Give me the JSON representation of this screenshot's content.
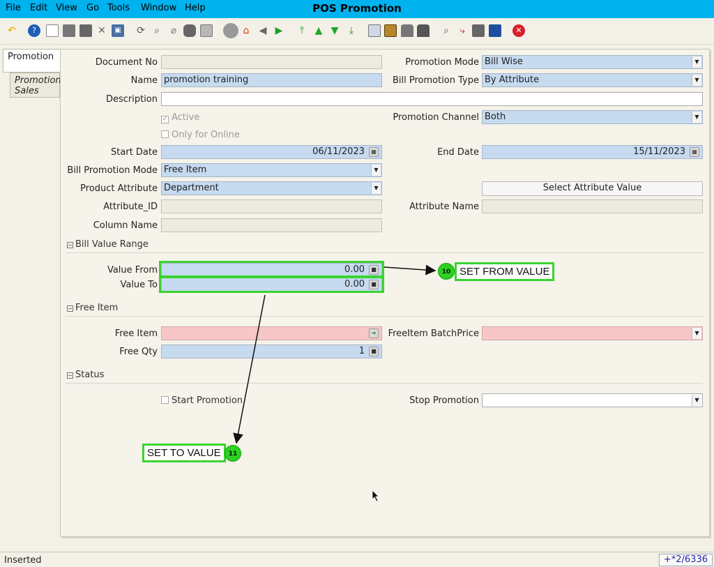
{
  "window": {
    "title": "POS Promotion"
  },
  "menu": [
    "File",
    "Edit",
    "View",
    "Go",
    "Tools",
    "Window",
    "Help"
  ],
  "toolbar_icons": [
    "undo-icon",
    "help-icon",
    "new-icon",
    "copy-icon",
    "delete-icon",
    "delete-selection-icon",
    "save-icon",
    "refresh-icon",
    "find-icon",
    "attachment-icon",
    "chat-icon",
    "history-icon",
    "detail-toggle-icon",
    "home-icon",
    "back-icon",
    "forward-icon",
    "first-record-icon",
    "previous-record-icon",
    "next-record-icon",
    "last-record-icon",
    "report-icon",
    "archive-icon",
    "print-preview-icon",
    "print-icon",
    "zoom-across-icon",
    "workflow-icon",
    "product-info-icon",
    "exit-icon",
    "close-icon"
  ],
  "tabs": [
    "Promotion",
    "Promotion Sales"
  ],
  "form": {
    "document_no": {
      "label": "Document No",
      "value": ""
    },
    "name": {
      "label": "Name",
      "value": "promotion training"
    },
    "description": {
      "label": "Description",
      "value": ""
    },
    "active": {
      "label": "Active",
      "checked": true
    },
    "only_online": {
      "label": "Only for Online",
      "checked": false
    },
    "start_date": {
      "label": "Start Date",
      "value": "06/11/2023"
    },
    "bill_promotion_mode": {
      "label": "Bill Promotion Mode",
      "value": "Free Item"
    },
    "product_attribute": {
      "label": "Product Attribute",
      "value": "Department"
    },
    "attribute_id": {
      "label": "Attribute_ID",
      "value": ""
    },
    "column_name": {
      "label": "Column Name",
      "value": ""
    },
    "promotion_mode": {
      "label": "Promotion Mode",
      "value": "Bill Wise"
    },
    "bill_promotion_type": {
      "label": "Bill Promotion Type",
      "value": "By Attribute"
    },
    "promotion_channel": {
      "label": "Promotion Channel",
      "value": "Both"
    },
    "end_date": {
      "label": "End Date",
      "value": "15/11/2023"
    },
    "select_attribute_button": "Select Attribute Value",
    "attribute_name": {
      "label": "Attribute Name",
      "value": ""
    }
  },
  "sections": {
    "bill_value_range": "Bill Value Range",
    "free_item": "Free Item",
    "status": "Status"
  },
  "bill_value": {
    "value_from": {
      "label": "Value From",
      "value": "0.00"
    },
    "value_to": {
      "label": "Value To",
      "value": "0.00"
    }
  },
  "free": {
    "free_item": {
      "label": "Free Item",
      "value": ""
    },
    "free_qty": {
      "label": "Free Qty",
      "value": "1"
    },
    "batch_price": {
      "label": "FreeItem BatchPrice",
      "value": ""
    }
  },
  "status_section": {
    "start_promotion": {
      "label": "Start Promotion",
      "checked": false
    },
    "stop_promotion": {
      "label": "Stop Promotion",
      "value": ""
    }
  },
  "annotations": {
    "step10": {
      "number": "10",
      "text": "SET FROM VALUE"
    },
    "step11": {
      "number": "11",
      "text": "SET TO VALUE"
    },
    "color": "#39d42f"
  },
  "statusbar": {
    "text": "Inserted",
    "record_info": "+*2/6336"
  }
}
